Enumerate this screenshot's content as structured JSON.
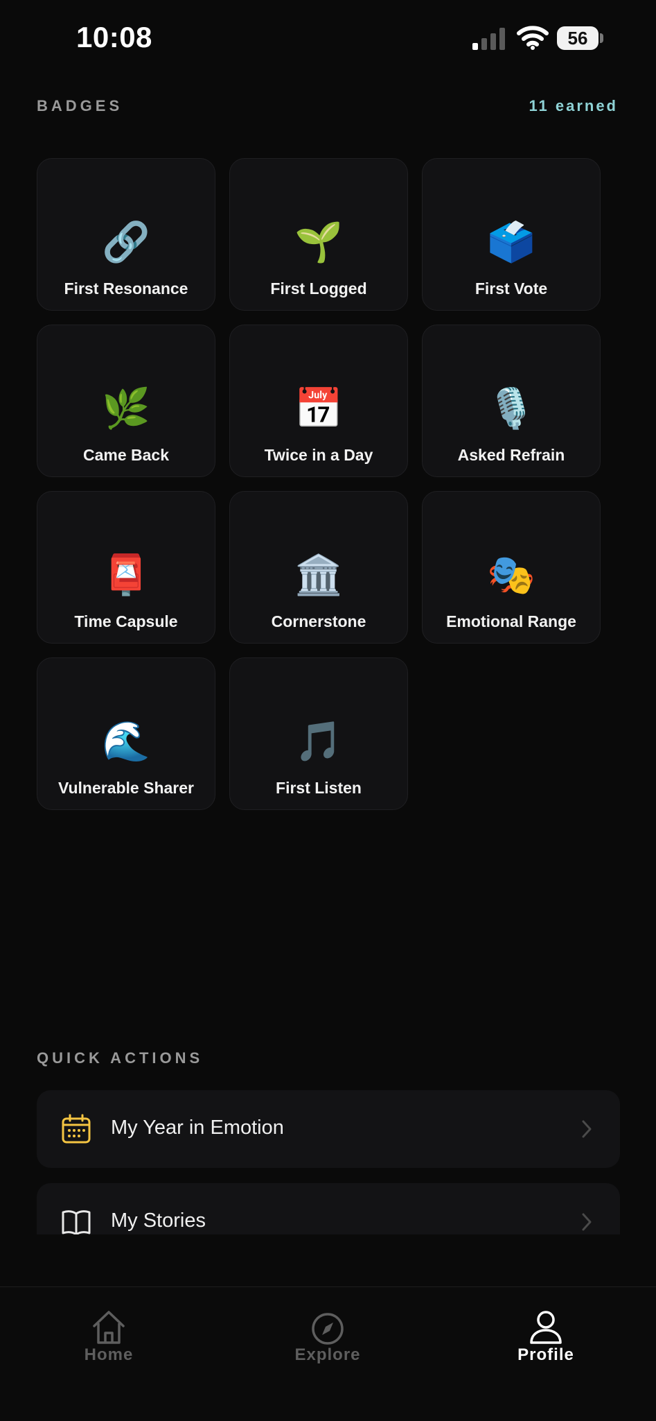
{
  "status_bar": {
    "time": "10:08",
    "battery": "56"
  },
  "badges": {
    "title": "BADGES",
    "earned": "11 earned",
    "items": [
      {
        "label": "First Resonance",
        "emoji": "🔗",
        "icon": "link-icon"
      },
      {
        "label": "First Logged",
        "emoji": "🌱",
        "icon": "seedling-icon"
      },
      {
        "label": "First Vote",
        "emoji": "🗳️",
        "icon": "ballot-box-icon"
      },
      {
        "label": "Came Back",
        "emoji": "🌿",
        "icon": "herb-icon"
      },
      {
        "label": "Twice in a Day",
        "emoji": "📅",
        "icon": "calendar-icon"
      },
      {
        "label": "Asked Refrain",
        "emoji": "🎙️",
        "icon": "microphone-icon"
      },
      {
        "label": "Time Capsule",
        "emoji": "📮",
        "icon": "postbox-icon"
      },
      {
        "label": "Cornerstone",
        "emoji": "🏛️",
        "icon": "classical-building-icon"
      },
      {
        "label": "Emotional Range",
        "emoji": "🎭",
        "icon": "theater-masks-icon"
      },
      {
        "label": "Vulnerable Sharer",
        "emoji": "🌊",
        "icon": "wave-icon"
      },
      {
        "label": "First Listen",
        "emoji": "🎵",
        "icon": "music-note-icon"
      }
    ]
  },
  "quick_actions": {
    "title": "QUICK ACTIONS",
    "items": [
      {
        "label": "My Year in Emotion",
        "icon": "calendar-icon",
        "icon_color": "#f5c542"
      },
      {
        "label": "My Stories",
        "icon": "book-icon",
        "icon_color": "#e8e8e8"
      }
    ]
  },
  "tabbar": {
    "items": [
      {
        "label": "Home",
        "icon": "home-icon",
        "active": false
      },
      {
        "label": "Explore",
        "icon": "compass-icon",
        "active": false
      },
      {
        "label": "Profile",
        "icon": "profile-icon",
        "active": true
      }
    ]
  }
}
